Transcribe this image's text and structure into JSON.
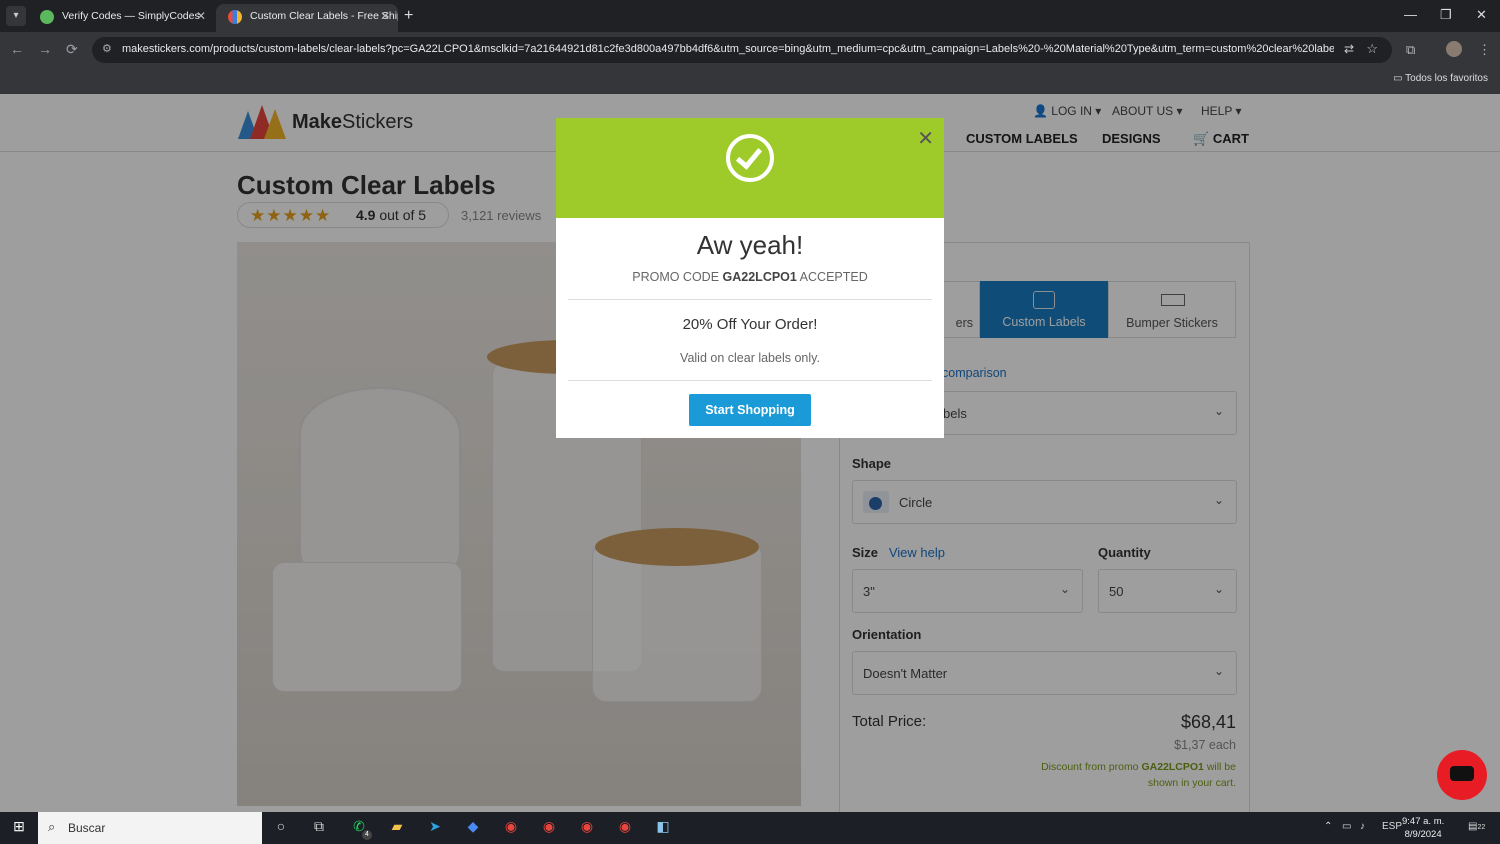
{
  "browser": {
    "tabs": [
      {
        "title": "Verify Codes — SimplyCodes"
      },
      {
        "title": "Custom Clear Labels - Free Ship"
      }
    ],
    "url": "makestickers.com/products/custom-labels/clear-labels?pc=GA22LCPO1&msclkid=7a21644921d81c2fe3d800a497bb4df6&utm_source=bing&utm_medium=cpc&utm_campaign=Labels%20-%20Material%20Type&utm_term=custom%20clear%20labe...",
    "bookmarks_label": "Todos los favoritos"
  },
  "site": {
    "logo": {
      "bold": "Make",
      "rest": "Stickers"
    },
    "topnav": [
      "LOG IN",
      "ABOUT US",
      "HELP"
    ],
    "mainnav": [
      "CUSTOM LABELS",
      "DESIGNS",
      "CART"
    ],
    "title": "Custom Clear Labels",
    "rating": {
      "score": "4.9",
      "out_of": "out of 5",
      "reviews": "3,121 reviews",
      "stars": 4.9
    },
    "product_tabs": [
      {
        "label": "ers"
      },
      {
        "label": "Custom Labels"
      },
      {
        "label": "Bumper Stickers"
      }
    ],
    "comparison_link": "comparison",
    "material_value": "bels",
    "shape": {
      "label": "Shape",
      "value": "Circle"
    },
    "size": {
      "label": "Size",
      "help": "View help",
      "value": "3\""
    },
    "quantity": {
      "label": "Quantity",
      "value": "50"
    },
    "orientation": {
      "label": "Orientation",
      "value": "Doesn't Matter"
    },
    "total": {
      "label": "Total Price:",
      "price": "$68,41",
      "each": "$1,37 each"
    },
    "discount_note": {
      "prefix": "Discount from promo",
      "code": "GA22LCPO1",
      "line1_end": "will be",
      "line2": "shown in your cart."
    }
  },
  "modal": {
    "heading": "Aw yeah!",
    "promo_prefix": "PROMO CODE",
    "promo_code": "GA22LCPO1",
    "promo_suffix": "ACCEPTED",
    "offer": "20% Off Your Order!",
    "valid": "Valid on clear labels only.",
    "button": "Start Shopping"
  },
  "taskbar": {
    "search_placeholder": "Buscar",
    "lang": "ESP",
    "time": "9:47 a. m.",
    "date": "8/9/2024",
    "whatsapp_badge": "4",
    "notif_badge": "22"
  },
  "colors": {
    "modal_header": "#9ecb2a",
    "button": "#1a9ad6",
    "active_tab": "#1b7bc2",
    "chat": "#e81c24"
  }
}
